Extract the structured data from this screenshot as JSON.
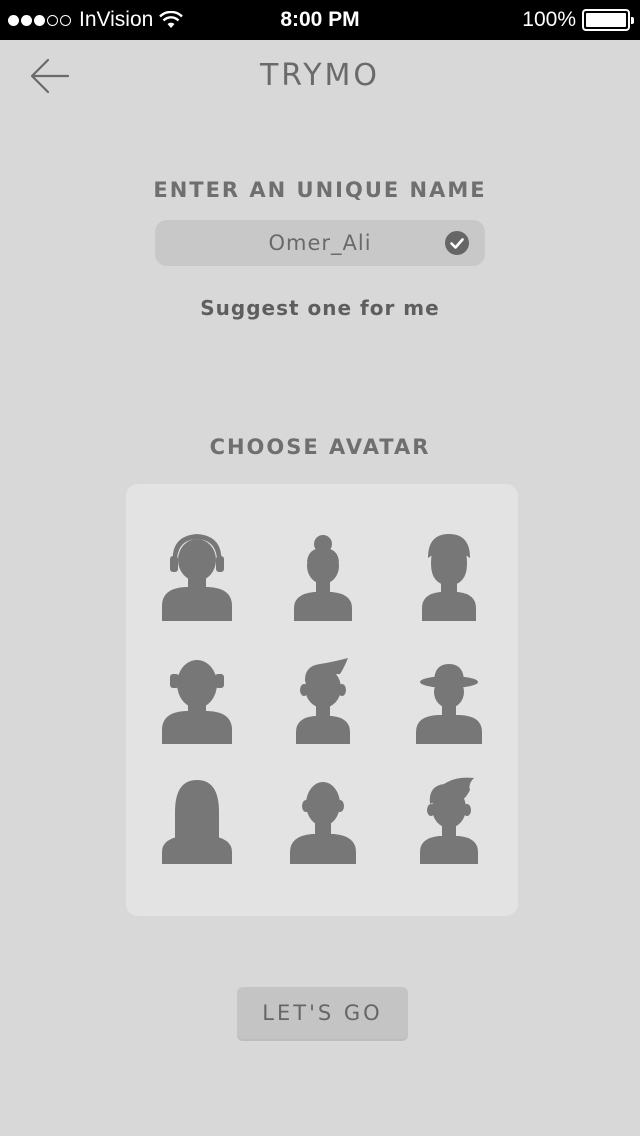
{
  "status_bar": {
    "carrier": "InVision",
    "time": "8:00 PM",
    "battery": "100%",
    "signal_bars_filled": 3,
    "signal_bars_total": 5
  },
  "header": {
    "title": "TRYMO",
    "back_icon": "arrow-left-icon"
  },
  "name_section": {
    "label": "ENTER AN UNIQUE NAME",
    "value": "Omer_Ali",
    "status_icon": "check-circle-icon",
    "suggest_link": "Suggest one for me"
  },
  "avatar_section": {
    "label": "CHOOSE AVATAR",
    "avatars": [
      "avatar-headphones-icon",
      "avatar-bun-hair-icon",
      "avatar-short-hair-icon",
      "avatar-earmuffs-icon",
      "avatar-quiff-icon",
      "avatar-hat-icon",
      "avatar-long-hair-icon",
      "avatar-bald-icon",
      "avatar-spiky-hair-icon"
    ]
  },
  "cta": {
    "label": "LET'S GO"
  },
  "colors": {
    "background": "#d8d8d8",
    "panel": "#e3e3e3",
    "field": "#c8c8c8",
    "avatar_fill": "#777777",
    "text": "#6f6f6f"
  }
}
